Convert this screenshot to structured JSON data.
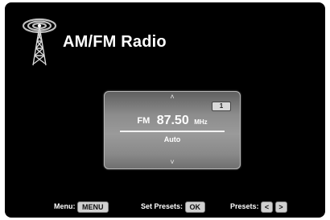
{
  "app": {
    "title": "AM/FM Radio",
    "icon": "radio-tower-icon"
  },
  "tuner": {
    "preset_number": "1",
    "band": "FM",
    "frequency": "87.50",
    "unit": "MHz",
    "mode": "Auto",
    "up_arrow": "˄",
    "down_arrow": "˅"
  },
  "footer": {
    "menu_label": "Menu:",
    "menu_key": "MENU",
    "set_presets_label": "Set Presets:",
    "set_presets_key": "OK",
    "presets_label": "Presets:",
    "prev_key": "<",
    "next_key": ">"
  },
  "colors": {
    "background": "#000000",
    "panel": "#8c8c8c",
    "text": "#ffffff",
    "key": "#d0d0d0"
  }
}
